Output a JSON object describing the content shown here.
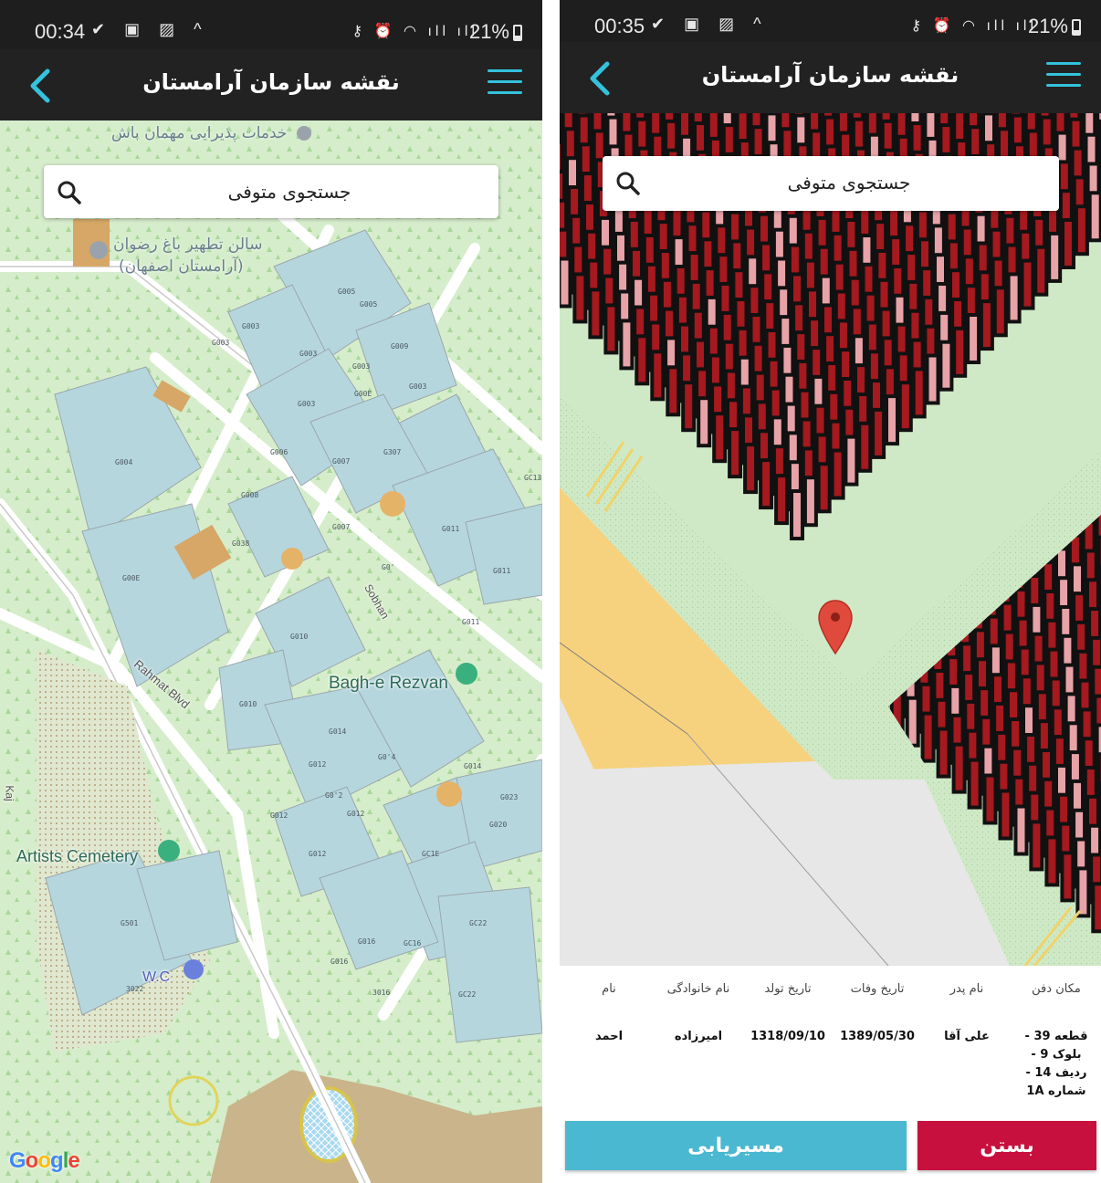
{
  "screens": [
    {
      "status_bar": {
        "time": "00:34",
        "battery": "21%"
      },
      "app_bar": {
        "title": "نقشه سازمان آرامستان"
      },
      "search": {
        "placeholder": "جستجوی متوفی"
      },
      "map": {
        "place_labels": {
          "bagh_e_rezvan": "Bagh-e Rezvan",
          "artists_cemetery": "Artists Cemetery",
          "wc": "W.C",
          "rahmat_blvd": "Rahmat Blvd",
          "sobhan": "Sobhan",
          "kaj": "Kaj",
          "hall_name": "سالن تطهیر باغ رضوان",
          "hall_sub": "(آرامستان اصفهان)",
          "guest_service": "خدمات پذیرایی مهمان باش"
        },
        "plot_labels": [
          "G001",
          "G005",
          "G003",
          "G003",
          "G009",
          "G003",
          "G00E",
          "G00",
          "G007",
          "G307",
          "G004",
          "G008",
          "G038",
          "G006",
          "G010",
          "G0'",
          "G011",
          "G011",
          "G010",
          "G014",
          "G0'4",
          "G014",
          "G012",
          "G0'2",
          "G012",
          "G012",
          "G016",
          "G023",
          "G020",
          "G022",
          "G501",
          "3022",
          "G016",
          "G022",
          "G013"
        ],
        "attribution": "Google"
      }
    },
    {
      "status_bar": {
        "time": "00:35",
        "battery": "21%"
      },
      "app_bar": {
        "title": "نقشه سازمان آرامستان"
      },
      "search": {
        "placeholder": "جستجوی متوفی"
      },
      "grave_info": {
        "headers": {
          "burial_place": "مکان دفن",
          "father_name": "نام پدر",
          "death_date": "تاریخ وفات",
          "birth_date": "تاریخ تولد",
          "family_name": "نام خانوادگی",
          "first_name": "نام"
        },
        "values": {
          "burial_place": [
            "قطعه 39 -",
            "بلوک 9 -",
            "ردیف 14 -",
            "شماره 1A"
          ],
          "father_name": "علی آقا",
          "death_date": "1389/05/30",
          "birth_date": "1318/09/10",
          "family_name": "امیرزاده",
          "first_name": "احمد"
        }
      },
      "buttons": {
        "route": "مسیریابی",
        "close": "بستن"
      }
    }
  ],
  "colors": {
    "accent_cyan": "#34c2dc",
    "route_button": "#4ab8d0",
    "close_button": "#c8103e",
    "app_bar": "#222222",
    "plot_dark_red": "#a5191f",
    "plot_pink": "#e7a3a8",
    "map_green": "#cfe9c6",
    "block_blue": "#b6d6de",
    "orange_zone": "#f7d27e"
  },
  "icons": [
    "back-arrow-icon",
    "hamburger-menu-icon",
    "search-icon",
    "map-pin-icon",
    "wifi-icon",
    "signal-icon",
    "alarm-icon",
    "key-icon",
    "check-icon",
    "image-icon"
  ]
}
